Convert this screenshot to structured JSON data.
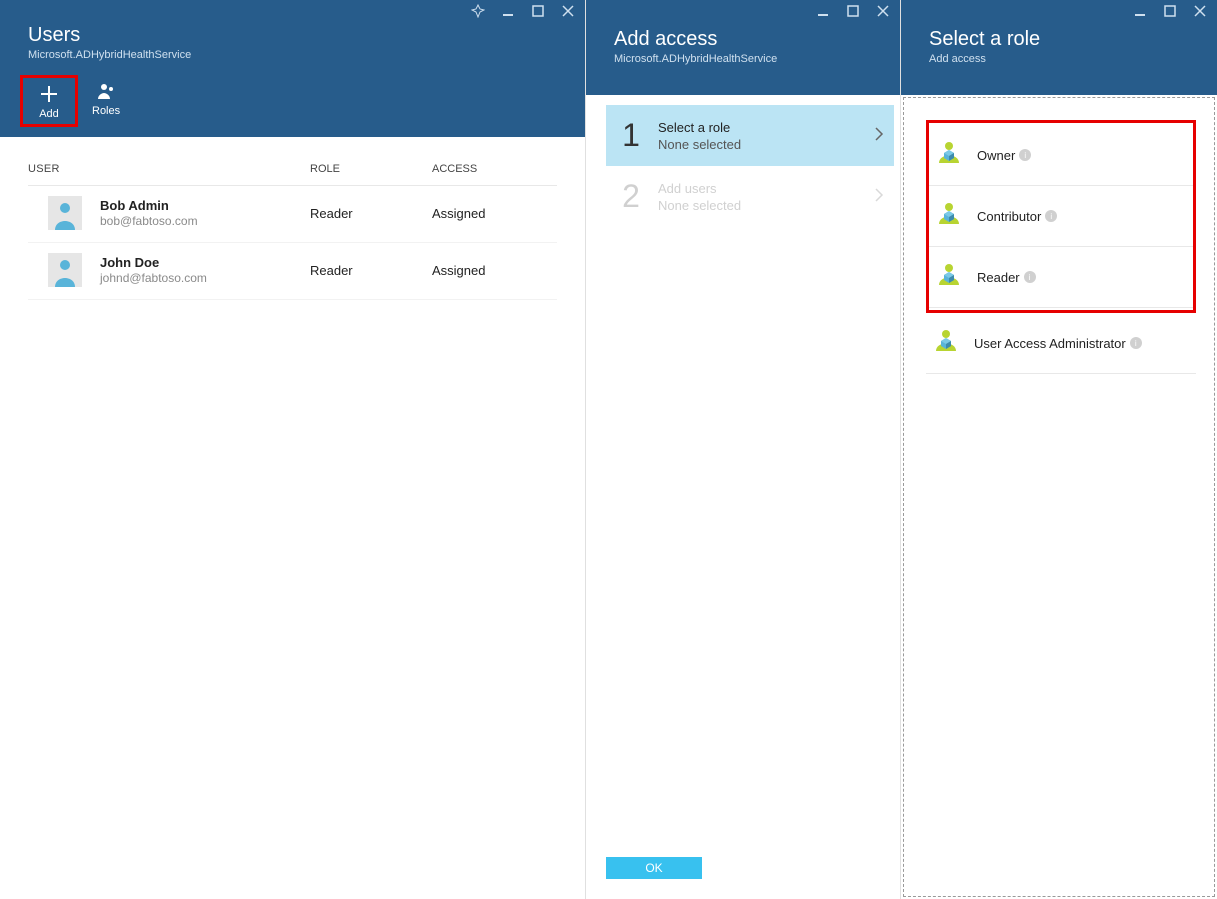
{
  "blade1": {
    "title": "Users",
    "subtitle": "Microsoft.ADHybridHealthService",
    "toolbar": {
      "add": "Add",
      "roles": "Roles"
    },
    "columns": {
      "user": "USER",
      "role": "ROLE",
      "access": "ACCESS"
    },
    "rows": [
      {
        "name": "Bob Admin",
        "email": "bob@fabtoso.com",
        "role": "Reader",
        "access": "Assigned"
      },
      {
        "name": "John Doe",
        "email": "johnd@fabtoso.com",
        "role": "Reader",
        "access": "Assigned"
      }
    ]
  },
  "blade2": {
    "title": "Add access",
    "subtitle": "Microsoft.ADHybridHealthService",
    "steps": [
      {
        "num": "1",
        "title": "Select a role",
        "sub": "None selected"
      },
      {
        "num": "2",
        "title": "Add users",
        "sub": "None selected"
      }
    ],
    "ok": "OK"
  },
  "blade3": {
    "title": "Select a role",
    "subtitle": "Add access",
    "roles_highlighted": [
      {
        "label": "Owner"
      },
      {
        "label": "Contributor"
      },
      {
        "label": "Reader"
      }
    ],
    "roles_other": [
      {
        "label": "User Access Administrator"
      }
    ]
  }
}
